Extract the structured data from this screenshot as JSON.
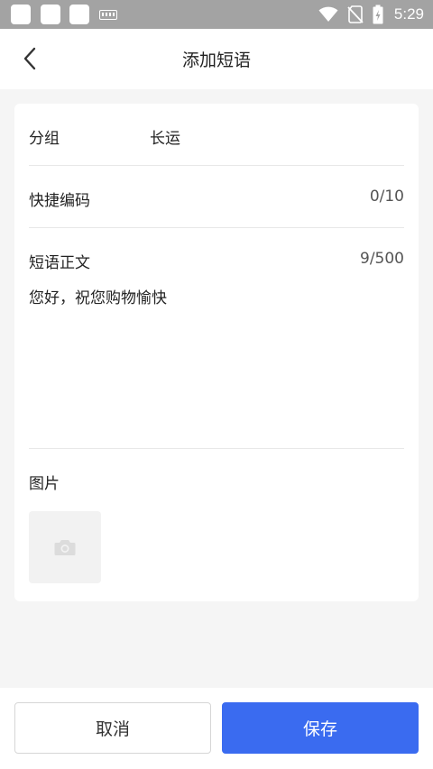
{
  "status_bar": {
    "time": "5:29",
    "icons": [
      "notification-square-icon",
      "notification-square-icon",
      "notification-square-icon",
      "keyboard-icon",
      "wifi-icon",
      "no-sim-icon",
      "battery-charging-icon"
    ]
  },
  "header": {
    "title": "添加短语",
    "back_icon": "chevron-left-icon"
  },
  "form": {
    "group": {
      "label": "分组",
      "value": "长运"
    },
    "shortcut": {
      "label": "快捷编码",
      "counter": "0/10",
      "value": ""
    },
    "phrase": {
      "label": "短语正文",
      "counter": "9/500",
      "value": "您好，祝您购物愉快"
    },
    "image": {
      "label": "图片",
      "add_icon": "camera-icon"
    }
  },
  "footer": {
    "cancel_label": "取消",
    "save_label": "保存"
  },
  "colors": {
    "primary": "#3a6bf0",
    "status_bar": "#a3a3a3",
    "background": "#f5f5f5"
  }
}
